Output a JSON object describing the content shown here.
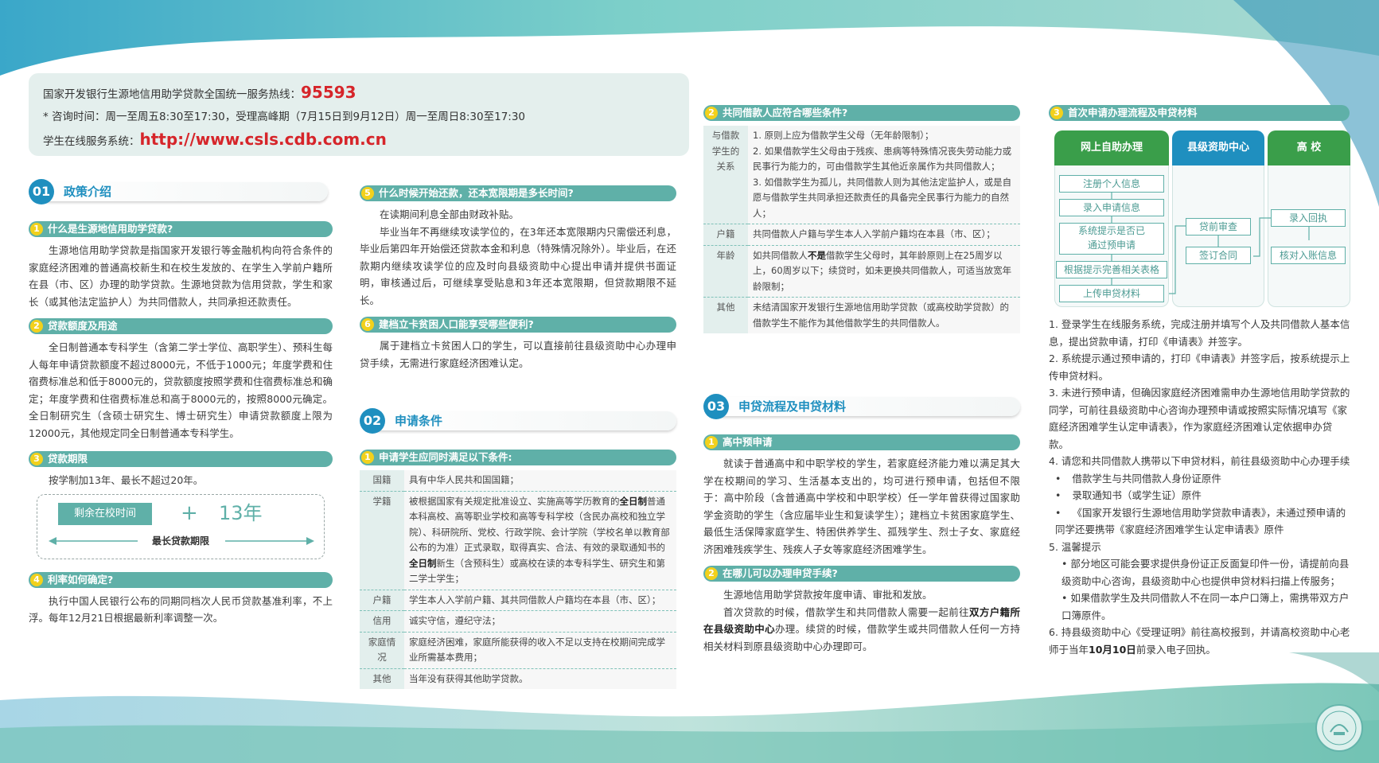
{
  "hotline": {
    "line1_label": "国家开发银行生源地信用助学贷款全国统一服务热线：",
    "line1_number": "95593",
    "line2": "* 咨询时间：周一至周五8:30至17:30，受理高峰期（7月15日到9月12日）周一至周日8:30至17:30",
    "line3_label": "学生在线服务系统：",
    "line3_url": "http://www.csls.cdb.com.cn"
  },
  "colors": {
    "teal": "#5fb0a8",
    "blue": "#1f8fbf",
    "red": "#d6252a",
    "yellow": "#f2d11c",
    "green": "#3a9e4a"
  },
  "s01": {
    "num": "01",
    "title": "政策介绍",
    "q1": {
      "n": "1",
      "title": "什么是生源地信用助学贷款?",
      "body": "生源地信用助学贷款是指国家开发银行等金融机构向符合条件的家庭经济困难的普通高校新生和在校生发放的、在学生入学前户籍所在县（市、区）办理的助学贷款。生源地贷款为信用贷款，学生和家长（或其他法定监护人）为共同借款人，共同承担还款责任。"
    },
    "q2": {
      "n": "2",
      "title": "贷款额度及用途",
      "body": "全日制普通本专科学生（含第二学士学位、高职学生）、预科生每人每年申请贷款额度不超过8000元，不低于1000元；年度学费和住宿费标准总和低于8000元的，贷款额度按照学费和住宿费标准总和确定；年度学费和住宿费标准总和高于8000元的，按照8000元确定。全日制研究生（含硕士研究生、博士研究生）申请贷款额度上限为12000元，其他规定同全日制普通本专科学生。"
    },
    "q3": {
      "n": "3",
      "title": "贷款期限",
      "body": "按学制加13年、最长不超过20年。",
      "box_label": "剩余在校时间",
      "plus": "+",
      "years": "13年",
      "arrow_label": "最长贷款期限"
    },
    "q4": {
      "n": "4",
      "title": "利率如何确定?",
      "body": "执行中国人民银行公布的同期同档次人民币贷款基准利率，不上浮。每年12月21日根据最新利率调整一次。"
    }
  },
  "s05": {
    "q5": {
      "n": "5",
      "title": "什么时候开始还款，还本宽限期是多长时间?",
      "p1": "在读期间利息全部由财政补贴。",
      "p2": "毕业当年不再继续攻读学位的，在3年还本宽限期内只需偿还利息，毕业后第四年开始偿还贷款本金和利息（特殊情况除外）。毕业后，在还款期内继续攻读学位的应及时向县级资助中心提出申请并提供书面证明，审核通过后，可继续享受贴息和3年还本宽限期，但贷款期限不延长。"
    },
    "q6": {
      "n": "6",
      "title": "建档立卡贫困人口能享受哪些便利?",
      "body": "属于建档立卡贫困人口的学生，可以直接前往县级资助中心办理申贷手续，无需进行家庭经济困难认定。"
    }
  },
  "s02": {
    "num": "02",
    "title": "申请条件",
    "q1": {
      "n": "1",
      "title": "申请学生应同时满足以下条件:"
    },
    "rows": [
      {
        "k": "国籍",
        "v": "具有中华人民共和国国籍；"
      },
      {
        "k": "学籍",
        "v_a": "被根据国家有关规定批准设立、实施高等学历教育的",
        "v_b": "全日制",
        "v_c": "普通本科高校、高等职业学校和高等专科学校（含民办高校和独立学院）、科研院所、党校、行政学院、会计学院（学校名单以教育部公布的为准）正式录取，取得真实、合法、有效的录取通知书的",
        "v_d": "全日制",
        "v_e": "新生（含预科生）或高校在读的本专科学生、研究生和第二学士学生；"
      },
      {
        "k": "户籍",
        "v": "学生本人入学前户籍、其共同借款人户籍均在本县（市、区）；"
      },
      {
        "k": "信用",
        "v": "诚实守信，遵纪守法；"
      },
      {
        "k": "家庭情况",
        "v": "家庭经济困难，家庭所能获得的收入不足以支持在校期间完成学业所需基本费用；"
      },
      {
        "k": "其他",
        "v": "当年没有获得其他助学贷款。"
      }
    ]
  },
  "s02b": {
    "q2": {
      "n": "2",
      "title": "共同借款人应符合哪些条件?"
    },
    "rows": [
      {
        "k": "与借款学生的关系",
        "v1": "1. 原则上应为借款学生父母（无年龄限制）；",
        "v2": "2. 如果借款学生父母由于残疾、患病等特殊情况丧失劳动能力或民事行为能力的，可由借款学生其他近亲属作为共同借款人；",
        "v3": "3. 如借款学生为孤儿，共同借款人则为其他法定监护人，或是自愿与借款学生共同承担还款责任的具备完全民事行为能力的自然人；"
      },
      {
        "k": "户籍",
        "v": "共同借款人户籍与学生本人入学前户籍均在本县（市、区）；"
      },
      {
        "k": "年龄",
        "v_a": "如共同借款人",
        "v_b": "不是",
        "v_c": "借款学生父母时，其年龄原则上在25周岁以上，60周岁以下；续贷时，如未更换共同借款人，可适当放宽年龄限制；"
      },
      {
        "k": "其他",
        "v": "未结清国家开发银行生源地信用助学贷款（或高校助学贷款）的借款学生不能作为其他借款学生的共同借款人。"
      }
    ]
  },
  "s03": {
    "num": "03",
    "title": "申贷流程及申贷材料",
    "q1": {
      "n": "1",
      "title": "高中预申请",
      "body": "就读于普通高中和中职学校的学生，若家庭经济能力难以满足其大学在校期间的学习、生活基本支出的，均可进行预申请，包括但不限于：高中阶段（含普通高中学校和中职学校）任一学年曾获得过国家助学金资助的学生（含应届毕业生和复读学生）；建档立卡贫困家庭学生、最低生活保障家庭学生、特困供养学生、孤残学生、烈士子女、家庭经济困难残疾学生、残疾人子女等家庭经济困难学生。"
    },
    "q2": {
      "n": "2",
      "title": "在哪儿可以办理申贷手续?",
      "p1": "生源地信用助学贷款按年度申请、审批和发放。",
      "p2_a": "首次贷款的时候，借款学生和共同借款人需要一起前往",
      "p2_b": "双方户籍所在县级资助中心",
      "p2_c": "办理。续贷的时候，借款学生或共同借款人任何一方持相关材料到原县级资助中心办理即可。"
    },
    "q3": {
      "n": "3",
      "title": "首次申请办理流程及申贷材料"
    }
  },
  "flow": {
    "col1_title": "网上自助办理",
    "col2_title": "县级资助中心",
    "col3_title": "高 校",
    "c1": [
      "注册个人信息",
      "录入申请信息",
      "系统提示是否已",
      "通过预申请",
      "根据提示完善相关表格",
      "上传申贷材料"
    ],
    "c2": [
      "贷前审查",
      "签订合同"
    ],
    "c3": [
      "录入回执",
      "核对入账信息"
    ]
  },
  "steps": {
    "s1": "1. 登录学生在线服务系统，完成注册并填写个人及共同借款人基本信息，提出贷款申请，打印《申请表》并签字。",
    "s2": "2. 系统提示通过预申请的，打印《申请表》并签字后，按系统提示上传申贷材料。",
    "s3": "3. 未进行预申请，但确因家庭经济困难需申办生源地信用助学贷款的同学，可前往县级资助中心咨询办理预申请或按照实际情况填写《家庭经济困难学生认定申请表》，作为家庭经济困难认定依据申办贷款。",
    "s4": "4. 请您和共同借款人携带以下申贷材料，前往县级资助中心办理手续",
    "s4a": "借款学生与共同借款人身份证原件",
    "s4b": "录取通知书（或学生证）原件",
    "s4c": "《国家开发银行生源地信用助学贷款申请表》，未通过预申请的同学还要携带《家庭经济困难学生认定申请表》原件",
    "s5": "5. 温馨提示",
    "s5a": "• 部分地区可能会要求提供身份证正反面复印件一份，请提前向县级资助中心咨询，县级资助中心也提供申贷材料扫描上传服务；",
    "s5b": "• 如果借款学生及共同借款人不在同一本户口簿上，需携带双方户口簿原件。",
    "s6_a": "6. 持县级资助中心《受理证明》前往高校报到，并请高校资助中心老师于当年",
    "s6_b": "10月10日",
    "s6_c": "前录入电子回执。"
  }
}
